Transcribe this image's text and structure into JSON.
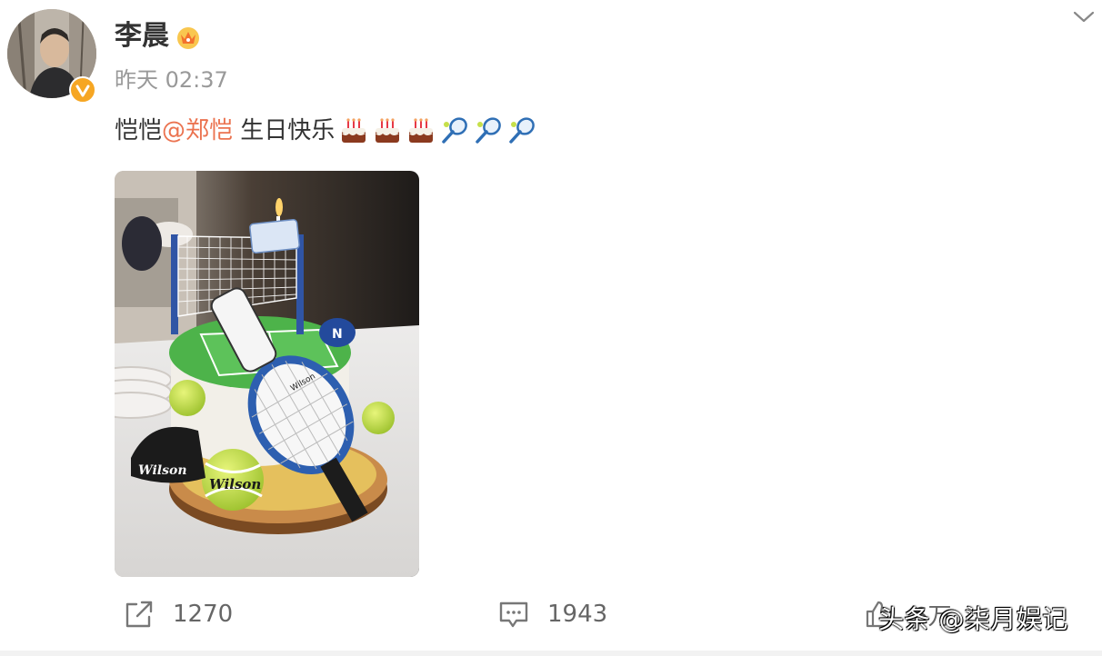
{
  "post": {
    "author": "李晨",
    "time": "昨天 02:37",
    "text_prefix": "恺恺",
    "mention": "@郑恺",
    "text_suffix": " 生日快乐",
    "emojis": [
      "cake-emoji",
      "cake-emoji",
      "cake-emoji",
      "tennis-racket-emoji",
      "tennis-racket-emoji",
      "tennis-racket-emoji"
    ],
    "photo_text": {
      "racket_brand": "Wilson",
      "ball_brand": "Wilson",
      "sign_brand": "Wilson"
    }
  },
  "actions": {
    "repost_count": "1270",
    "comment_count": "1943",
    "like_count": "6万"
  },
  "watermark": "头条 @柒月娱记",
  "icons": {
    "collapse": "chevron-down-icon",
    "verified": "verified-badge-icon",
    "crown": "crown-icon",
    "repost": "repost-icon",
    "comment": "comment-icon",
    "like": "thumb-up-icon"
  },
  "colors": {
    "mention": "#eb7350",
    "verified": "#f6a623",
    "meta_text": "#999999"
  }
}
